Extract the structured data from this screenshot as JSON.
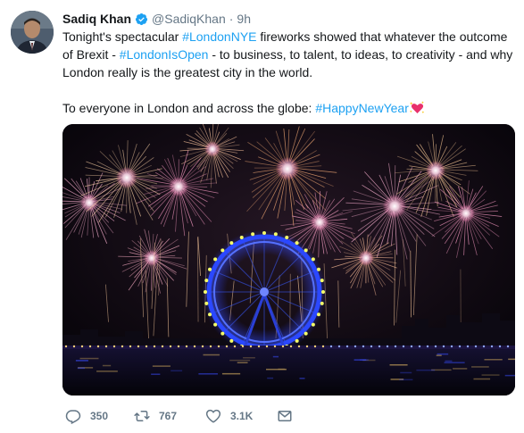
{
  "author": {
    "name": "Sadiq Khan",
    "handle": "@SadiqKhan",
    "separator": "·",
    "time": "9h",
    "avatar_icon": "user-avatar",
    "verified_icon": "verified-badge-icon"
  },
  "tweet": {
    "line1_prefix": "Tonight's spectacular ",
    "hashtag1": "#LondonNYE",
    "line1_suffix": " fireworks showed that whatever the outcome of Brexit - ",
    "hashtag2": "#LondonIsOpen",
    "line1_rest": " - to business, to talent, to ideas, to creativity - and why London really is the greatest city in the world.",
    "line2_prefix": "To everyone in London and across the globe: ",
    "hashtag3": "#HappyNewYear",
    "emoji_icon": "sparkling-heart-icon"
  },
  "media": {
    "image_icon": "london-eye-fireworks-image"
  },
  "actions": {
    "reply_count": "350",
    "retweet_count": "767",
    "like_count": "3.1K",
    "reply_icon": "reply-icon",
    "retweet_icon": "retweet-icon",
    "like_icon": "heart-icon",
    "dm_icon": "envelope-icon"
  },
  "colors": {
    "link": "#1da1f2",
    "muted": "#657786",
    "text": "#14171a"
  }
}
